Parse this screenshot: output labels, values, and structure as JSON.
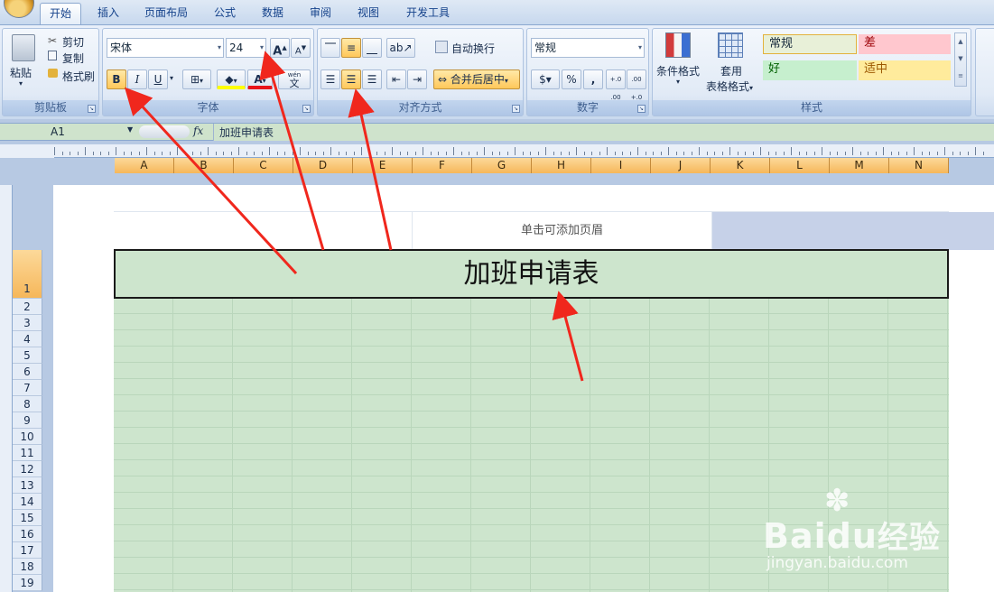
{
  "tabs": [
    "开始",
    "插入",
    "页面布局",
    "公式",
    "数据",
    "审阅",
    "视图",
    "开发工具"
  ],
  "clipboard": {
    "paste": "粘贴",
    "cut": "剪切",
    "copy": "复制",
    "format_painter": "格式刷",
    "group": "剪贴板"
  },
  "font": {
    "name": "宋体",
    "size": "24",
    "grow": "A",
    "shrink": "A",
    "bold": "B",
    "italic": "I",
    "underline": "U",
    "font_color": "A",
    "phonetic": "wén",
    "phonetic_char": "文",
    "group": "字体"
  },
  "alignment": {
    "wrap": "自动换行",
    "merge": "合并后居中",
    "group": "对齐方式"
  },
  "number": {
    "format": "常规",
    "percent": "%",
    "comma": ",",
    "inc_decimal": "+.0 .00",
    "dec_decimal": ".00 +.0",
    "group": "数字"
  },
  "styles": {
    "conditional": "条件格式",
    "table_line1": "套用",
    "table_line2": "表格格式",
    "normal": "常规",
    "bad": "差",
    "good": "好",
    "neutral": "适中",
    "group": "样式"
  },
  "formula_bar": {
    "name_box": "A1",
    "fx": "fx",
    "content": "加班申请表"
  },
  "columns": [
    "A",
    "B",
    "C",
    "D",
    "E",
    "F",
    "G",
    "H",
    "I",
    "J",
    "K",
    "L",
    "M",
    "N"
  ],
  "rows": [
    "1",
    "2",
    "3",
    "4",
    "5",
    "6",
    "7",
    "8",
    "9",
    "10",
    "11",
    "12",
    "13",
    "14",
    "15",
    "16",
    "17",
    "18",
    "19"
  ],
  "page": {
    "header_prompt": "单击可添加页眉",
    "title": "加班申请表"
  },
  "colors": {
    "cell_fill": "#cde5cd",
    "arrow": "#f0271d",
    "highlight": "#ffc85a"
  },
  "watermark": {
    "brand": "Baidu",
    "brand_cn": "经验",
    "url": "jingyan.baidu.com"
  }
}
